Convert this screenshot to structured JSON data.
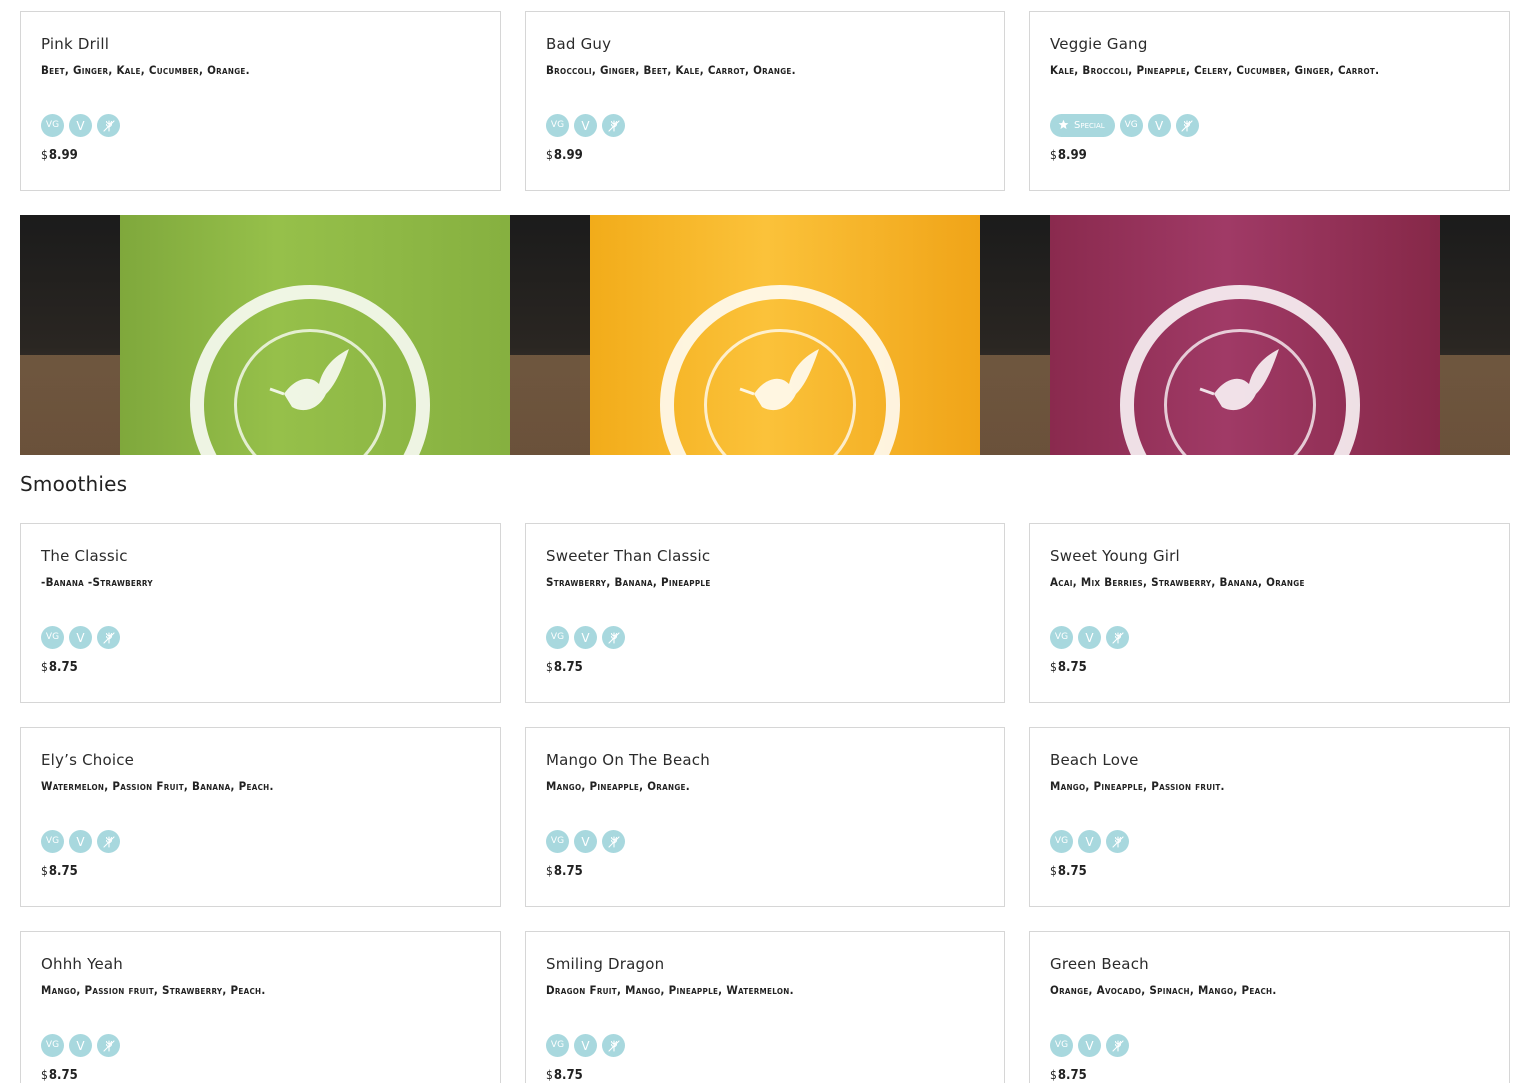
{
  "colors": {
    "badge": "#a8d8de",
    "border": "#d6d6d6",
    "text": "#2b2b2b"
  },
  "badge_labels": {
    "vegan": "VG",
    "vegetarian": "V",
    "gluten_free_icon": "no-wheat-icon",
    "special": "Special",
    "special_icon": "star-icon"
  },
  "currency": "$",
  "juices": [
    {
      "name": "Pink Drill",
      "description": "Beet, Ginger, Kale, Cucumber, Orange.",
      "price": "8.99",
      "special": false
    },
    {
      "name": "Bad Guy",
      "description": "Broccoli, Ginger, Beet, Kale, Carrot, Orange.",
      "price": "8.99",
      "special": false
    },
    {
      "name": "Veggie Gang",
      "description": "Kale, Broccoli, Pineapple, Celery, Cucumber, Ginger, Carrot.",
      "price": "8.99",
      "special": true
    }
  ],
  "banner": {
    "image_alt_icon": "smoothie-cups-photo",
    "cup_colors": [
      "#8cb846",
      "#f8b82c",
      "#963460"
    ]
  },
  "smoothies_title": "Smoothies",
  "smoothies": [
    {
      "name": "The Classic",
      "description": "-Banana -Strawberry",
      "price": "8.75"
    },
    {
      "name": "Sweeter Than Classic",
      "description": "Strawberry, Banana, Pineapple",
      "price": "8.75"
    },
    {
      "name": "Sweet Young Girl",
      "description": "Acai, Mix Berries, Strawberry, Banana, Orange",
      "price": "8.75"
    },
    {
      "name": "Ely’s Choice",
      "description": "Watermelon, Passion Fruit, Banana, Peach.",
      "price": "8.75"
    },
    {
      "name": "Mango On The Beach",
      "description": "Mango, Pineapple, Orange.",
      "price": "8.75"
    },
    {
      "name": "Beach Love",
      "description": "Mango, Pineapple, Passion fruit.",
      "price": "8.75"
    },
    {
      "name": "Ohhh Yeah",
      "description": "Mango, Passion fruit, Strawberry, Peach.",
      "price": "8.75"
    },
    {
      "name": "Smiling Dragon",
      "description": "Dragon Fruit, Mango, Pineapple, Watermelon.",
      "price": "8.75"
    },
    {
      "name": "Green Beach",
      "description": "Orange, Avocado, Spinach, Mango, Peach.",
      "price": "8.75"
    }
  ]
}
